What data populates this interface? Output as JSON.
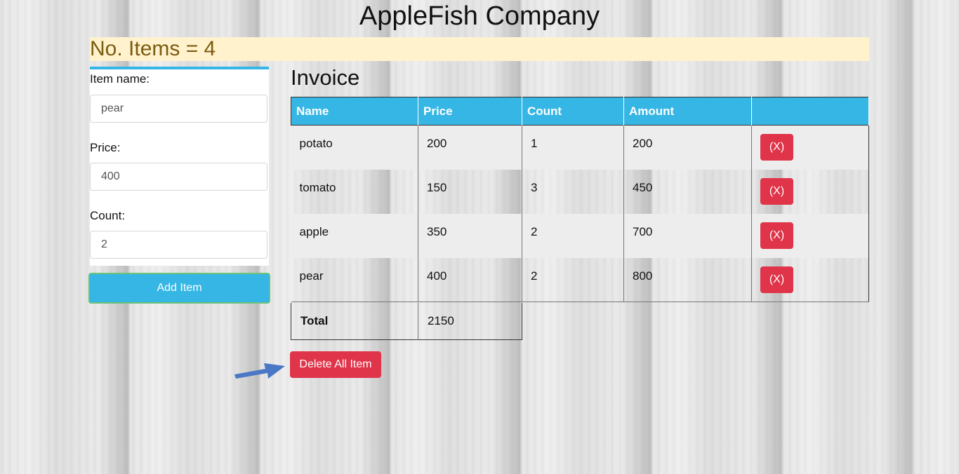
{
  "header": {
    "title": "AppleFish Company"
  },
  "banner": {
    "count_text": "No. Items = 4"
  },
  "form": {
    "item_name_label": "Item name:",
    "item_name_value": "pear",
    "price_label": "Price:",
    "price_value": "400",
    "count_label": "Count:",
    "count_value": "2",
    "add_button_label": "Add Item"
  },
  "invoice": {
    "heading": "Invoice",
    "columns": [
      "Name",
      "Price",
      "Count",
      "Amount",
      ""
    ],
    "rows": [
      {
        "name": "potato",
        "price": "200",
        "count": "1",
        "amount": "200",
        "action": "(X)"
      },
      {
        "name": "tomato",
        "price": "150",
        "count": "3",
        "amount": "450",
        "action": "(X)"
      },
      {
        "name": "apple",
        "price": "350",
        "count": "2",
        "amount": "700",
        "action": "(X)"
      },
      {
        "name": "pear",
        "price": "400",
        "count": "2",
        "amount": "800",
        "action": "(X)"
      }
    ],
    "total_label": "Total",
    "total_value": "2150",
    "delete_all_label": "Delete All Item"
  },
  "colors": {
    "accent": "#35b6e4",
    "danger": "#e0344a",
    "banner_bg": "#fff2cc",
    "banner_text": "#7a5b12",
    "arrow": "#4a78c6"
  },
  "icons": {
    "pointer_arrow": "arrow-right-icon"
  }
}
